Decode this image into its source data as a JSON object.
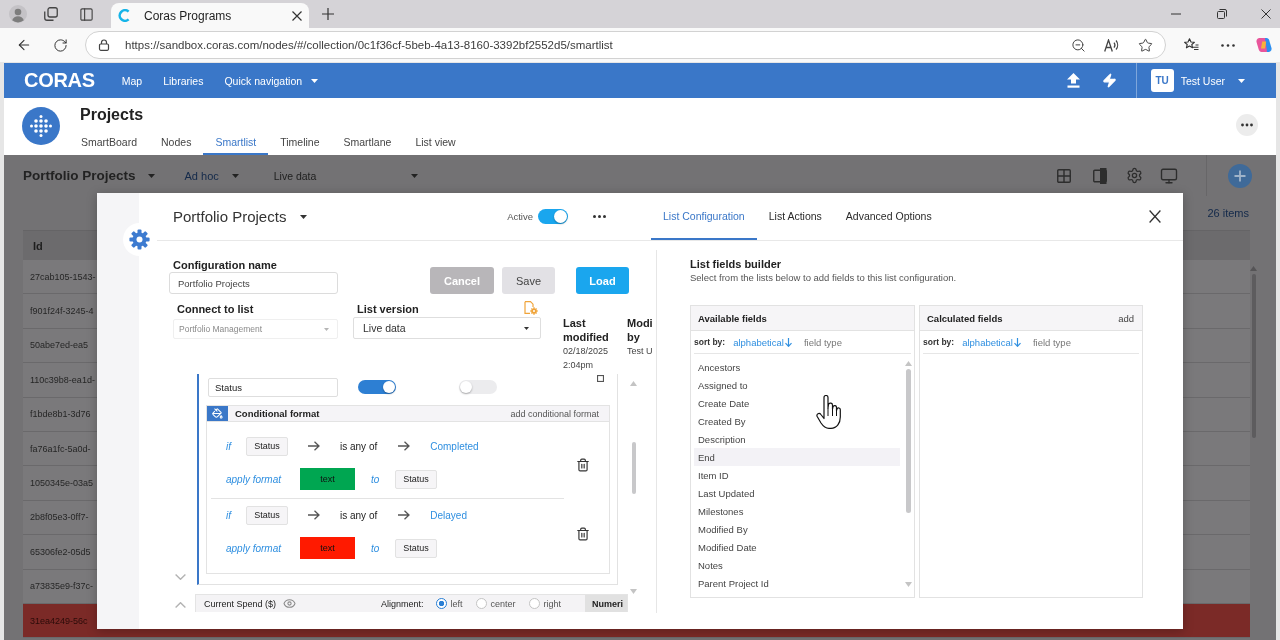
{
  "browser": {
    "tabs": [
      {
        "title": "Coras Programs",
        "selected": true
      }
    ],
    "url": "https://sandbox.coras.com/nodes/#/collection/0c1f36cf-5beb-4a13-8160-3392bf2552d5/smartlist"
  },
  "app_bar": {
    "logo": "CORAS",
    "nav": [
      {
        "label": "Map",
        "has_menu": false
      },
      {
        "label": "Libraries",
        "has_menu": false
      },
      {
        "label": "Quick navigation",
        "has_menu": true
      }
    ],
    "user": {
      "initials": "TU",
      "name": "Test User"
    }
  },
  "project": {
    "title": "Projects",
    "tabs": [
      {
        "label": "SmartBoard",
        "selected": false
      },
      {
        "label": "Nodes",
        "selected": false
      },
      {
        "label": "Smartlist",
        "selected": true
      },
      {
        "label": "Timeline",
        "selected": false
      },
      {
        "label": "Smartlane",
        "selected": false
      },
      {
        "label": "List view",
        "selected": false
      }
    ]
  },
  "smartlist": {
    "title": "Portfolio Projects",
    "view": "Ad hoc",
    "version": "Live data",
    "count": "26 items",
    "table": {
      "columns": [
        "Id"
      ],
      "rows": [
        {
          "id": "27cab105-1543-",
          "highlighted": false
        },
        {
          "id": "f901f24f-3245-4",
          "highlighted": false
        },
        {
          "id": "50abe7ed-ea5",
          "highlighted": false
        },
        {
          "id": "110c39b8-ea1d-",
          "highlighted": false
        },
        {
          "id": "f1bde8b1-3d76",
          "highlighted": false
        },
        {
          "id": "fa76a1fc-5a0d-",
          "highlighted": false
        },
        {
          "id": "1050345e-03a5",
          "highlighted": false
        },
        {
          "id": "2b8f05e3-0ff7-",
          "highlighted": false
        },
        {
          "id": "65306fe2-05d5",
          "highlighted": false
        },
        {
          "id": "a73835e9-f37c-",
          "highlighted": false
        },
        {
          "id": "31ea4249-56c",
          "highlighted": true
        }
      ]
    }
  },
  "dialog": {
    "title": "Portfolio Projects",
    "active": {
      "label": "Active",
      "on": true
    },
    "tabs": [
      {
        "label": "List Configuration",
        "selected": true
      },
      {
        "label": "List Actions",
        "selected": false
      },
      {
        "label": "Advanced Options",
        "selected": false
      }
    ],
    "configuration": {
      "name": {
        "label": "Configuration name",
        "value": "Portfolio Projects"
      },
      "buttons": [
        {
          "label": "Cancel",
          "kind": "cancel"
        },
        {
          "label": "Save",
          "kind": "secondary"
        },
        {
          "label": "Load",
          "kind": "primary"
        }
      ],
      "connect": {
        "label": "Connect to list",
        "value": "Portfolio Management",
        "disabled": true
      },
      "version": {
        "label": "List version",
        "value": "Live data"
      },
      "last_modified": {
        "label": "Last modified",
        "date": "02/18/2025",
        "time": "2:04pm"
      },
      "modified_by": {
        "label": "Modi by",
        "value": "Test U"
      }
    },
    "fields": [
      {
        "kind": "format",
        "name": "Status",
        "expanded": true,
        "toggles": [
          {
            "on": true
          },
          {
            "on": false
          }
        ],
        "conditional_format": {
          "title": "Conditional format",
          "action": "add conditional format",
          "rules": [
            {
              "if_label": "if",
              "field": "Status",
              "operator": "is any of",
              "value": "Completed",
              "apply_label": "apply format",
              "sample": "text",
              "color": "#00a651",
              "to_label": "to",
              "target": "Status"
            },
            {
              "if_label": "if",
              "field": "Status",
              "operator": "is any of",
              "value": "Delayed",
              "apply_label": "apply format",
              "sample": "text",
              "color": "#ff1a00",
              "to_label": "to",
              "target": "Status"
            }
          ]
        }
      },
      {
        "kind": "alignment",
        "name": "Current Spend ($)",
        "expanded": false,
        "alignment_label": "Alignment:",
        "alignments": [
          {
            "label": "left",
            "selected": true
          },
          {
            "label": "center",
            "selected": false
          },
          {
            "label": "right",
            "selected": false
          }
        ],
        "type": "Numeri"
      }
    ],
    "builder": {
      "title": "List fields builder",
      "description": "Select from the lists below to add fields to this list configuration.",
      "panels": [
        {
          "title": "Available fields",
          "sort_label": "sort by:",
          "sort_options": [
            {
              "label": "alphabetical",
              "selected": true
            },
            {
              "label": "field type",
              "selected": false
            }
          ],
          "items": [
            {
              "label": "Ancestors",
              "selected": false
            },
            {
              "label": "Assigned to",
              "selected": false
            },
            {
              "label": "Create Date",
              "selected": false
            },
            {
              "label": "Created By",
              "selected": false
            },
            {
              "label": "Description",
              "selected": false
            },
            {
              "label": "End",
              "selected": true
            },
            {
              "label": "Item ID",
              "selected": false
            },
            {
              "label": "Last Updated",
              "selected": false
            },
            {
              "label": "Milestones",
              "selected": false
            },
            {
              "label": "Modified By",
              "selected": false
            },
            {
              "label": "Modified Date",
              "selected": false
            },
            {
              "label": "Notes",
              "selected": false
            },
            {
              "label": "Parent Project Id",
              "selected": false
            }
          ]
        },
        {
          "title": "Calculated fields",
          "action": "add",
          "sort_label": "sort by:",
          "sort_options": [
            {
              "label": "alphabetical",
              "selected": true
            },
            {
              "label": "field type",
              "selected": false
            }
          ]
        }
      ]
    }
  }
}
